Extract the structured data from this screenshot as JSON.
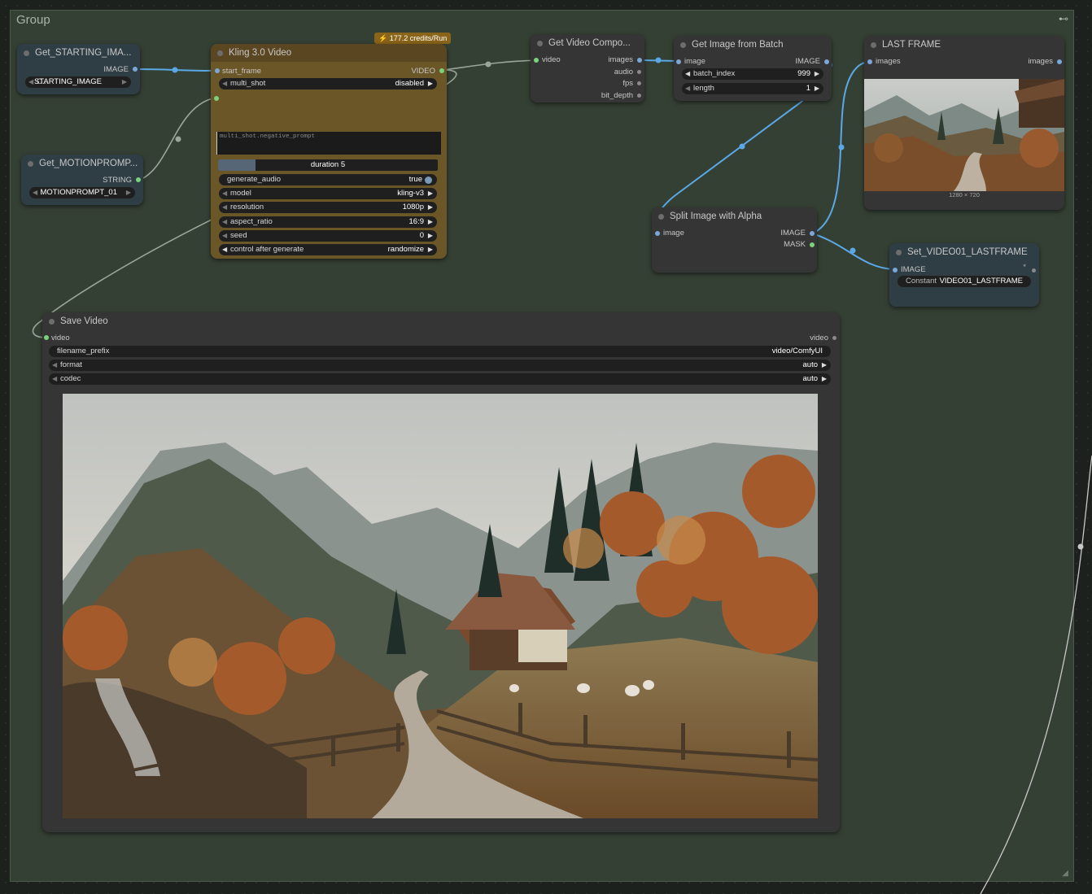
{
  "group": {
    "title": "Group",
    "pin_icon": "pin-icon"
  },
  "nodes": {
    "get_starting_image": {
      "title": "Get_STARTING_IMA...",
      "output": "IMAGE",
      "widget_prefix": "C...",
      "widget_value": "STARTING_IMAGE"
    },
    "get_motionprompt": {
      "title": "Get_MOTIONPROMP...",
      "output": "STRING",
      "widget_prefix": ".",
      "widget_value": "MOTIONPROMPT_01"
    },
    "kling": {
      "title": "Kling 3.0 Video",
      "badge": "177.2 credits/Run",
      "input": "start_frame",
      "output": "VIDEO",
      "multi_shot": {
        "label": "multi_shot",
        "value": "disabled"
      },
      "negative_prompt_placeholder": "multi_shot.negative_prompt",
      "duration": {
        "label": "duration",
        "value": "5",
        "fill_fraction": 0.17
      },
      "generate_audio": {
        "label": "generate_audio",
        "value": "true"
      },
      "model": {
        "label": "model",
        "value": "kling-v3"
      },
      "resolution": {
        "label": "resolution",
        "value": "1080p"
      },
      "aspect_ratio": {
        "label": "aspect_ratio",
        "value": "16:9"
      },
      "seed": {
        "label": "seed",
        "value": "0"
      },
      "control_after_generate": {
        "label": "control after generate",
        "value": "randomize"
      }
    },
    "get_video_components": {
      "title": "Get Video Compo...",
      "input": "video",
      "outputs": [
        "images",
        "audio",
        "fps",
        "bit_depth"
      ]
    },
    "get_image_from_batch": {
      "title": "Get Image from Batch",
      "input": "image",
      "output": "IMAGE",
      "batch_index": {
        "label": "batch_index",
        "value": "999"
      },
      "length": {
        "label": "length",
        "value": "1"
      }
    },
    "last_frame": {
      "title": "LAST FRAME",
      "input": "images",
      "output": "images",
      "caption": "1280 × 720"
    },
    "split_image": {
      "title": "Split Image with Alpha",
      "input": "image",
      "outputs": [
        "IMAGE",
        "MASK"
      ]
    },
    "set_lastframe": {
      "title": "Set_VIDEO01_LASTFRAME",
      "input": "IMAGE",
      "widget_label": "Constant",
      "widget_value": "VIDEO01_LASTFRAME"
    },
    "save_video": {
      "title": "Save Video",
      "input": "video",
      "output": "video",
      "filename_prefix": {
        "label": "filename_prefix",
        "value": "video/ComfyUI"
      },
      "format": {
        "label": "format",
        "value": "auto"
      },
      "codec": {
        "label": "codec",
        "value": "auto"
      }
    }
  },
  "colors": {
    "group_bg": "#354034",
    "link_blue": "#5aa9e6",
    "link_gray": "#9aa69a",
    "kling_body": "#6b5628",
    "badge": "#8a6418"
  }
}
